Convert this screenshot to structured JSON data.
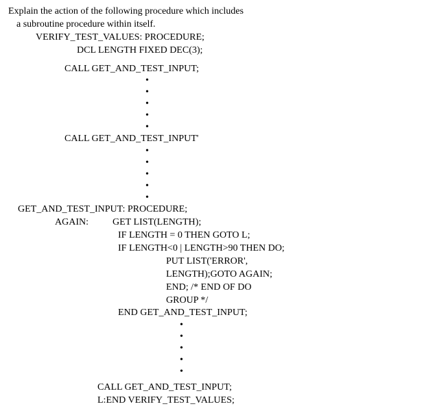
{
  "question": {
    "line1": "Explain the action of the following procedure which includes",
    "line2": "a subroutine procedure within itself."
  },
  "code": {
    "proc_header": "VERIFY_TEST_VALUES: PROCEDURE;",
    "dcl": "DCL LENGTH FIXED DEC(3);",
    "call1": "CALL GET_AND_TEST_INPUT;",
    "call2": "CALL GET_AND_TEST_INPUT'",
    "sub_header": "GET_AND_TEST_INPUT: PROCEDURE;",
    "again_label": "AGAIN:",
    "get_list": "GET LIST(LENGTH);",
    "if_zero": "IF LENGTH = 0 THEN GOTO L;",
    "if_range": "IF LENGTH<0 | LENGTH>90 THEN DO;",
    "put_list": "PUT LIST('ERROR',",
    "put_list2": "LENGTH);GOTO AGAIN;",
    "end_do": "END; /* END OF DO",
    "group": "GROUP */",
    "end_sub": "END GET_AND_TEST_INPUT;",
    "call3": "CALL GET_AND_TEST_INPUT;",
    "end_main": "L:END VERIFY_TEST_VALUES;",
    "bullet": "•"
  }
}
